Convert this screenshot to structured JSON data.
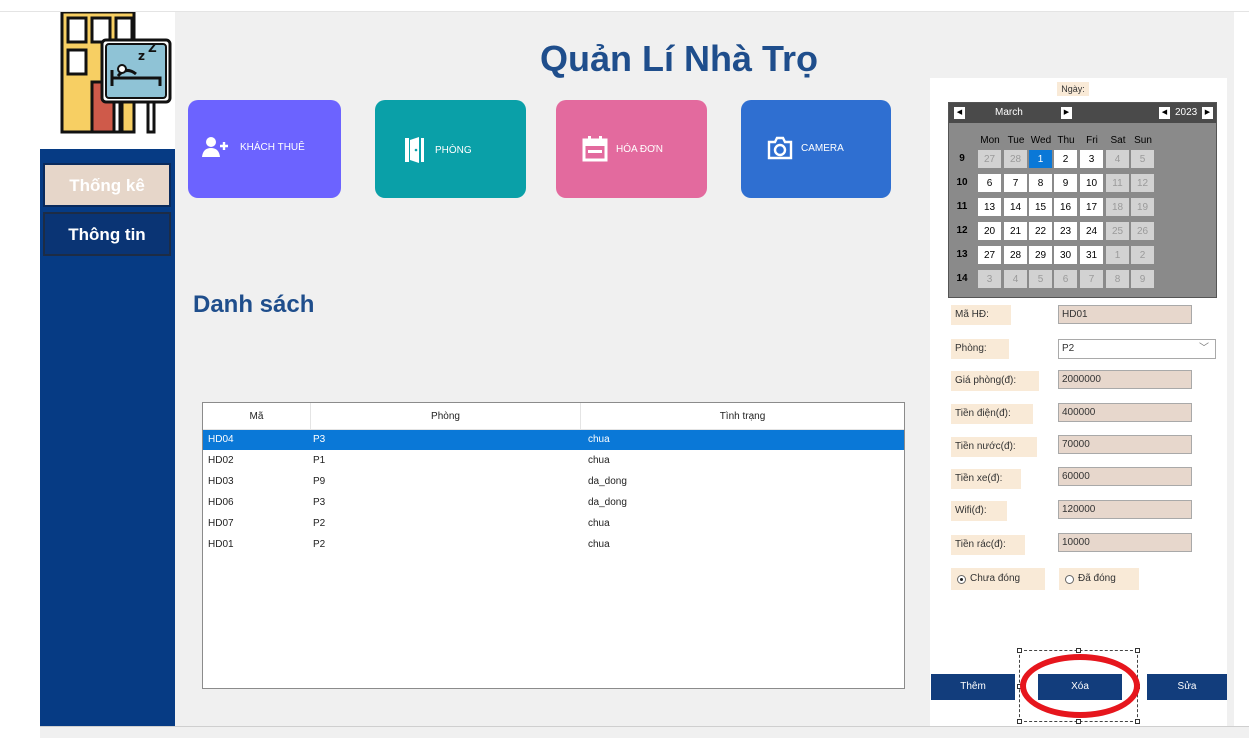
{
  "app": {
    "title": "Quản Lí Nhà Trọ",
    "section_title": "Danh sách"
  },
  "sidebar": {
    "items": [
      {
        "label": "Thống kê"
      },
      {
        "label": "Thông tin"
      }
    ]
  },
  "tiles": [
    {
      "label": "KHÁCH THUÊ",
      "icon": "add-user-icon"
    },
    {
      "label": "PHÒNG",
      "icon": "door-icon"
    },
    {
      "label": "HÓA ĐƠN",
      "icon": "calendar-icon"
    },
    {
      "label": "CAMERA",
      "icon": "camera-icon"
    }
  ],
  "table": {
    "columns": [
      "Mã",
      "Phòng",
      "Tình trạng"
    ],
    "rows": [
      {
        "ma": "HD04",
        "phong": "P3",
        "tinh_trang": "chua"
      },
      {
        "ma": "HD02",
        "phong": "P1",
        "tinh_trang": "chua"
      },
      {
        "ma": "HD03",
        "phong": "P9",
        "tinh_trang": "da_dong"
      },
      {
        "ma": "HD06",
        "phong": "P3",
        "tinh_trang": "da_dong"
      },
      {
        "ma": "HD07",
        "phong": "P2",
        "tinh_trang": "chua"
      },
      {
        "ma": "HD01",
        "phong": "P2",
        "tinh_trang": "chua"
      }
    ],
    "selected_row": 0
  },
  "calendar": {
    "label": "Ngày:",
    "month": "March",
    "year": "2023",
    "weekdays": [
      "Mon",
      "Tue",
      "Wed",
      "Thu",
      "Fri",
      "Sat",
      "Sun"
    ],
    "weeks": [
      {
        "num": "9",
        "days": [
          "27",
          "28",
          "1",
          "2",
          "3",
          "4",
          "5"
        ]
      },
      {
        "num": "10",
        "days": [
          "6",
          "7",
          "8",
          "9",
          "10",
          "11",
          "12"
        ]
      },
      {
        "num": "11",
        "days": [
          "13",
          "14",
          "15",
          "16",
          "17",
          "18",
          "19"
        ]
      },
      {
        "num": "12",
        "days": [
          "20",
          "21",
          "22",
          "23",
          "24",
          "25",
          "26"
        ]
      },
      {
        "num": "13",
        "days": [
          "27",
          "28",
          "29",
          "30",
          "31",
          "1",
          "2"
        ]
      },
      {
        "num": "14",
        "days": [
          "3",
          "4",
          "5",
          "6",
          "7",
          "8",
          "9"
        ]
      }
    ],
    "selected_day": "1",
    "nav_prev": "◀",
    "nav_next": "▶"
  },
  "form": {
    "ma_hd": {
      "label": "Mã HĐ:",
      "value": "HD01"
    },
    "phong": {
      "label": "Phòng:",
      "value": "P2"
    },
    "gia_phong": {
      "label": "Giá phòng(đ):",
      "value": "2000000"
    },
    "tien_dien": {
      "label": "Tiền điện(đ):",
      "value": "400000"
    },
    "tien_nuoc": {
      "label": "Tiền nước(đ):",
      "value": "70000"
    },
    "tien_xe": {
      "label": "Tiền xe(đ):",
      "value": "60000"
    },
    "wifi": {
      "label": "Wifi(đ):",
      "value": "120000"
    },
    "tien_rac": {
      "label": "Tiền rác(đ):",
      "value": "10000"
    },
    "status_unpaid": "Chưa đóng",
    "status_paid": "Đã đóng"
  },
  "actions": {
    "add": "Thêm",
    "delete": "Xóa",
    "edit": "Sửa"
  },
  "colors": {
    "sidebar": "#063b84",
    "accent": "#1f4e8c",
    "selection": "#0a78d7",
    "highlight_ring": "#e6161d"
  }
}
